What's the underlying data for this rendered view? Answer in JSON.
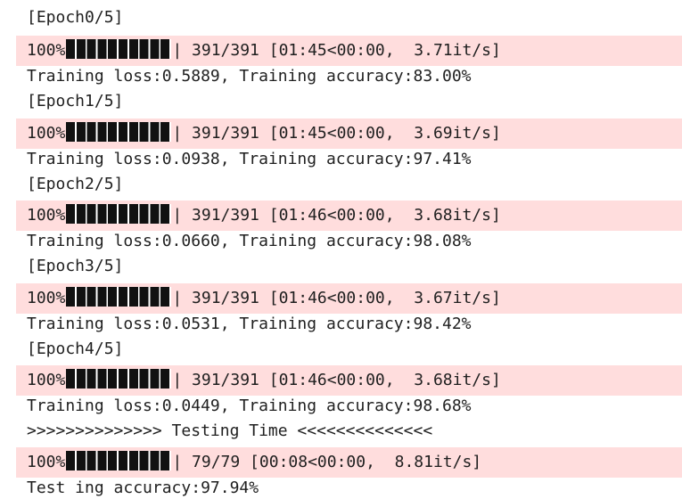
{
  "colors": {
    "stderr_background": "#ffdddd",
    "text": "#1f1f1f",
    "bar_fill": "#111111"
  },
  "lines": {
    "epoch0_header": "[Epoch0/5]",
    "epoch0_progress": {
      "percent": "100%",
      "fraction": 1.0,
      "stats": "| 391/391 [01:45<00:00,  3.71it/s]"
    },
    "epoch0_result": "Training loss:0.5889, Training accuracy:83.00%",
    "epoch1_header": "[Epoch1/5]",
    "epoch1_progress": {
      "percent": "100%",
      "fraction": 1.0,
      "stats": "| 391/391 [01:45<00:00,  3.69it/s]"
    },
    "epoch1_result": "Training loss:0.0938, Training accuracy:97.41%",
    "epoch2_header": "[Epoch2/5]",
    "epoch2_progress": {
      "percent": "100%",
      "fraction": 1.0,
      "stats": "| 391/391 [01:46<00:00,  3.68it/s]"
    },
    "epoch2_result": "Training loss:0.0660, Training accuracy:98.08%",
    "epoch3_header": "[Epoch3/5]",
    "epoch3_progress": {
      "percent": "100%",
      "fraction": 1.0,
      "stats": "| 391/391 [01:46<00:00,  3.67it/s]"
    },
    "epoch3_result": "Training loss:0.0531, Training accuracy:98.42%",
    "epoch4_header": "[Epoch4/5]",
    "epoch4_progress": {
      "percent": "100%",
      "fraction": 1.0,
      "stats": "| 391/391 [01:46<00:00,  3.68it/s]"
    },
    "epoch4_result": "Training loss:0.0449, Training accuracy:98.68%",
    "testing_banner": ">>>>>>>>>>>>>> Testing Time <<<<<<<<<<<<<<",
    "test_progress": {
      "percent": "100%",
      "fraction": 1.0,
      "stats": "| 79/79 [00:08<00:00,  8.81it/s]"
    },
    "test_result": "Test ing accuracy:97.94%"
  }
}
